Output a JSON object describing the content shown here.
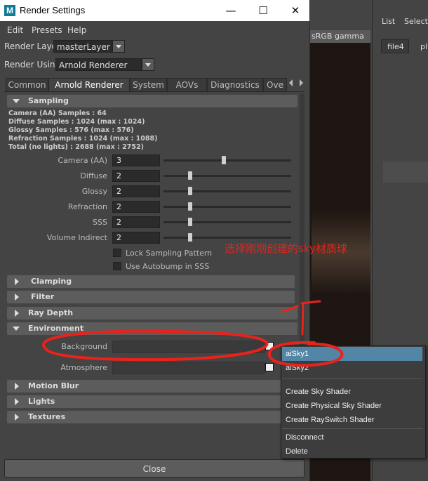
{
  "window": {
    "logo": "M",
    "title": "Render Settings",
    "controls": {
      "minimize": "—",
      "maximize": "☐",
      "close": "✕"
    }
  },
  "menubar": [
    "Edit",
    "Presets",
    "Help"
  ],
  "render_layer": {
    "label": "Render Layer",
    "value": "masterLayer"
  },
  "render_using": {
    "label": "Render Using",
    "value": "Arnold Renderer"
  },
  "tabs": [
    "Common",
    "Arnold Renderer",
    "System",
    "AOVs",
    "Diagnostics",
    "Ove"
  ],
  "active_tab": "Arnold Renderer",
  "sampling": {
    "title": "Sampling",
    "info": [
      "Camera (AA) Samples : 64",
      "Diffuse Samples : 1024 (max : 1024)",
      "Glossy Samples : 576 (max : 576)",
      "Refraction Samples : 1024 (max : 1088)",
      "Total (no lights) : 2688 (max : 2752)"
    ],
    "fields": [
      {
        "label": "Camera (AA)",
        "value": "3",
        "level": 0.47
      },
      {
        "label": "Diffuse",
        "value": "2",
        "level": 0.21
      },
      {
        "label": "Glossy",
        "value": "2",
        "level": 0.21
      },
      {
        "label": "Refraction",
        "value": "2",
        "level": 0.21
      },
      {
        "label": "SSS",
        "value": "2",
        "level": 0.21
      },
      {
        "label": "Volume Indirect",
        "value": "2",
        "level": 0.21
      }
    ],
    "checkboxes": [
      "Lock Sampling Pattern",
      "Use Autobump in SSS"
    ]
  },
  "sections": {
    "clamping": "Clamping",
    "filter": "Filter",
    "ray_depth": "Ray Depth",
    "environment": "Environment",
    "motion_blur": "Motion Blur",
    "lights": "Lights",
    "textures": "Textures"
  },
  "environment": {
    "background_label": "Background",
    "atmosphere_label": "Atmosphere"
  },
  "popup": {
    "items": [
      "aiSky1",
      "aiSky2"
    ],
    "selected": "aiSky1",
    "actions": [
      "Create Sky Shader",
      "Create Physical Sky Shader",
      "Create RaySwitch Shader"
    ],
    "extra": [
      "Disconnect",
      "Delete"
    ]
  },
  "close_label": "Close",
  "viewport": {
    "header": "sRGB gamma"
  },
  "right_panel": {
    "menu": [
      "List",
      "Selecte"
    ],
    "tabs": [
      "file4",
      "pl"
    ]
  },
  "annotation": {
    "text": "选择刚刚创建的sky材质球",
    "color": "#e8231c"
  }
}
